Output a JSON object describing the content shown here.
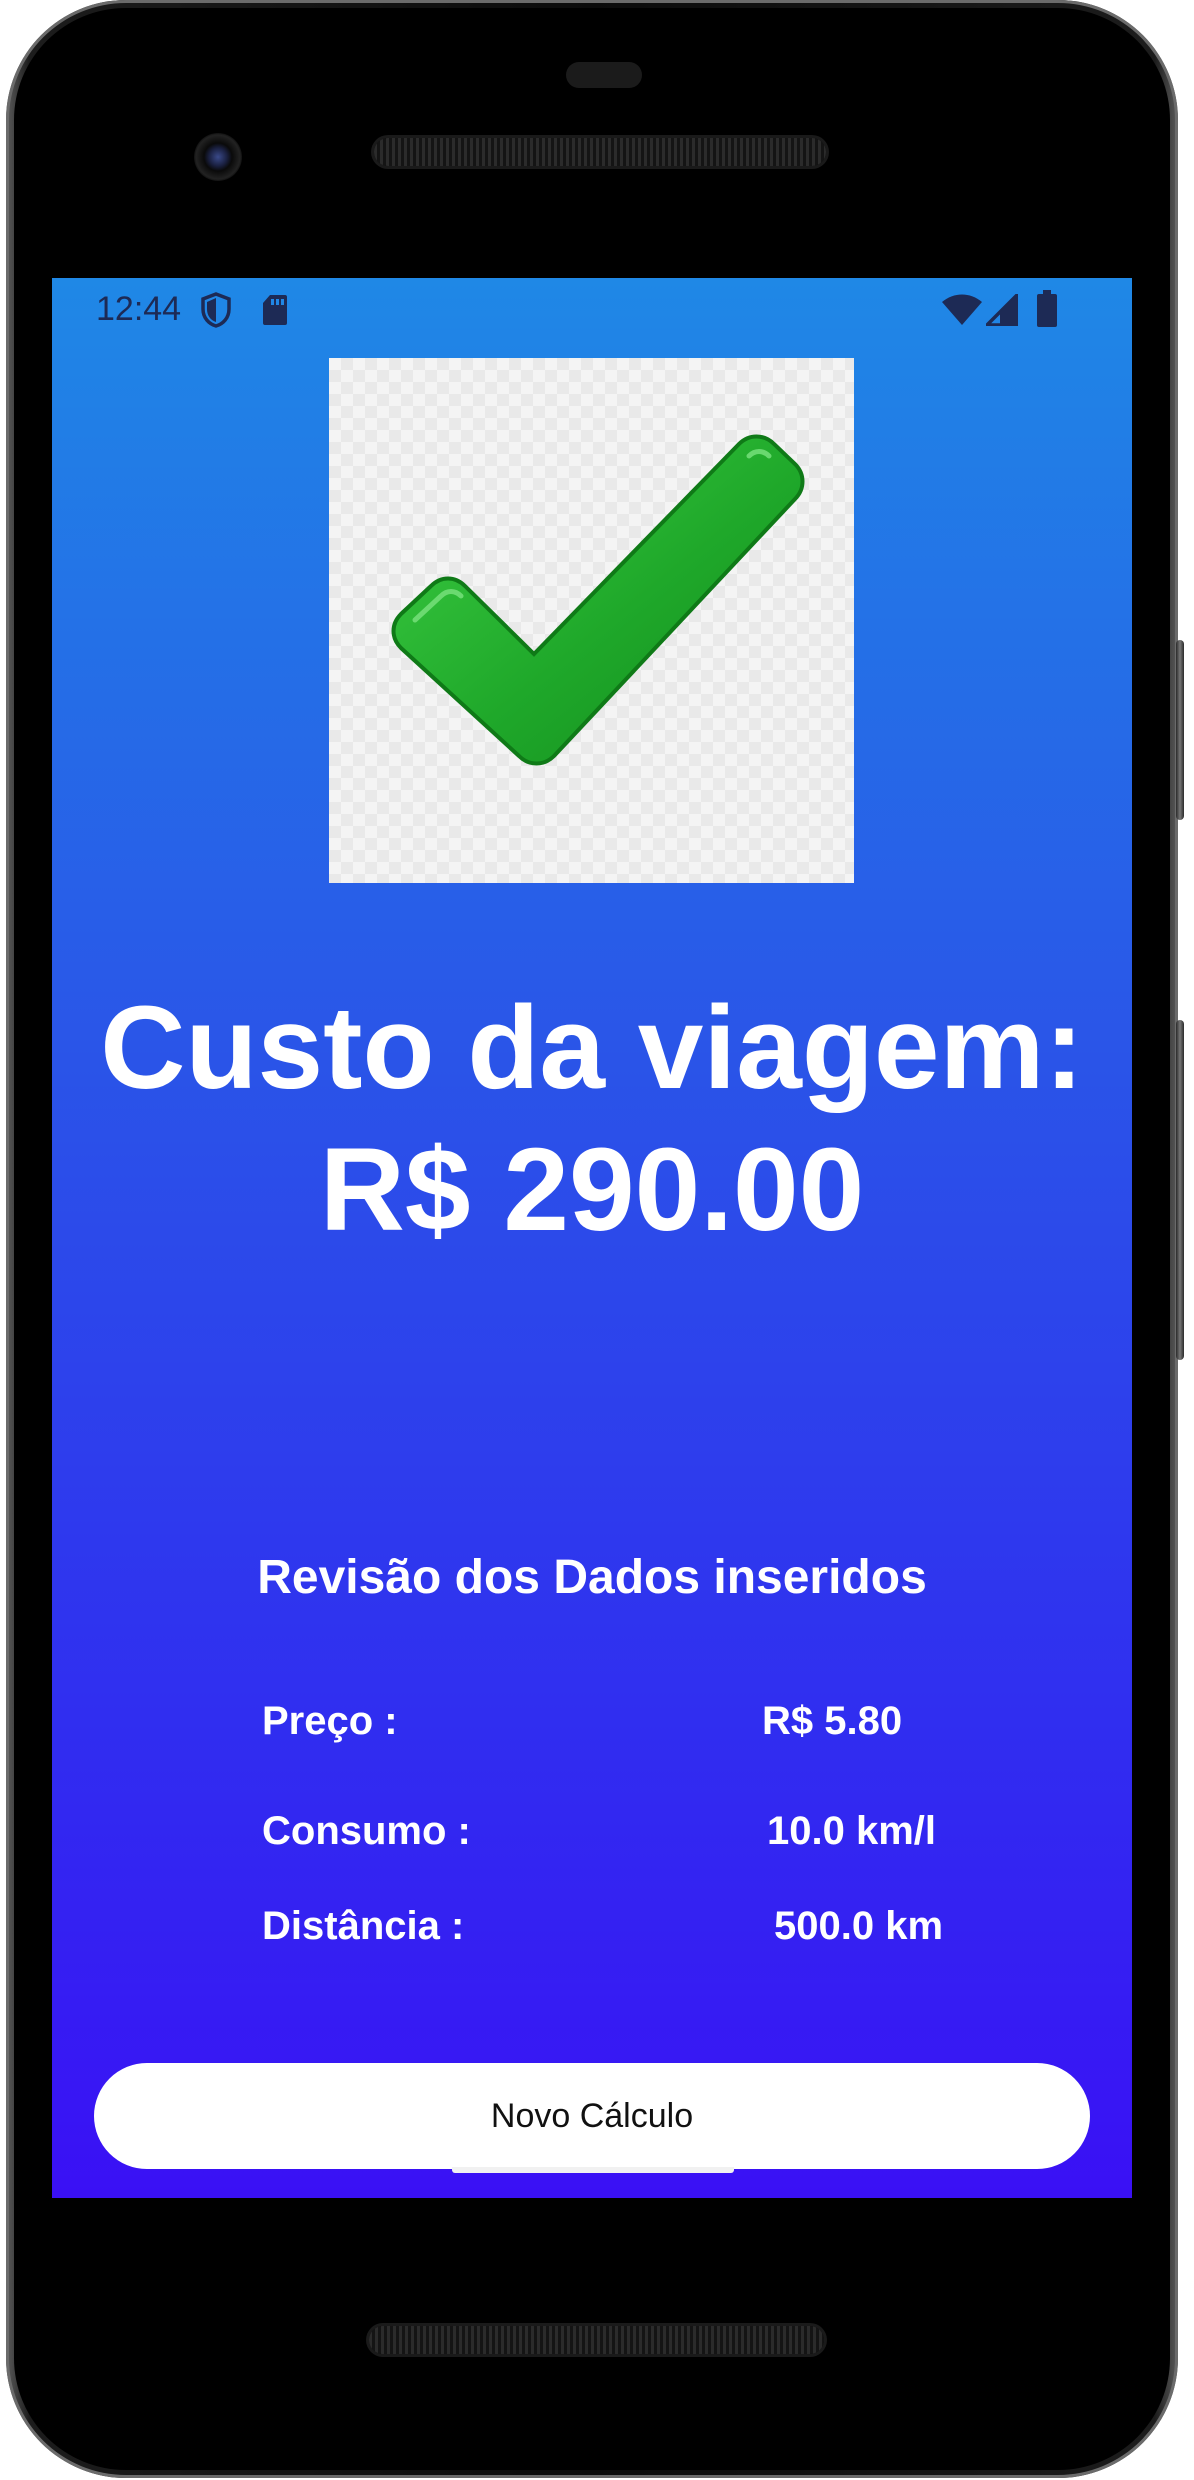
{
  "status_bar": {
    "time": "12:44",
    "left_icons": [
      "shield-icon",
      "sd-card-icon"
    ],
    "right_icons": [
      "wifi-icon",
      "cell-signal-icon",
      "battery-icon"
    ]
  },
  "result": {
    "image_icon": "checkmark-icon",
    "title": "Custo da viagem:",
    "value": "R$ 290.00"
  },
  "review": {
    "heading": "Revisão dos Dados inseridos",
    "rows": [
      {
        "label": "Preço :",
        "value": "R$ 5.80"
      },
      {
        "label": "Consumo :",
        "value": "10.0 km/l"
      },
      {
        "label": "Distância :",
        "value": "500.0 km"
      }
    ]
  },
  "actions": {
    "new_calc_label": "Novo Cálculo"
  },
  "colors": {
    "gradient_top": "#1f88e6",
    "gradient_bottom": "#3a10f5",
    "check_green": "#1fa82a",
    "text_on_bg": "#ffffff"
  }
}
